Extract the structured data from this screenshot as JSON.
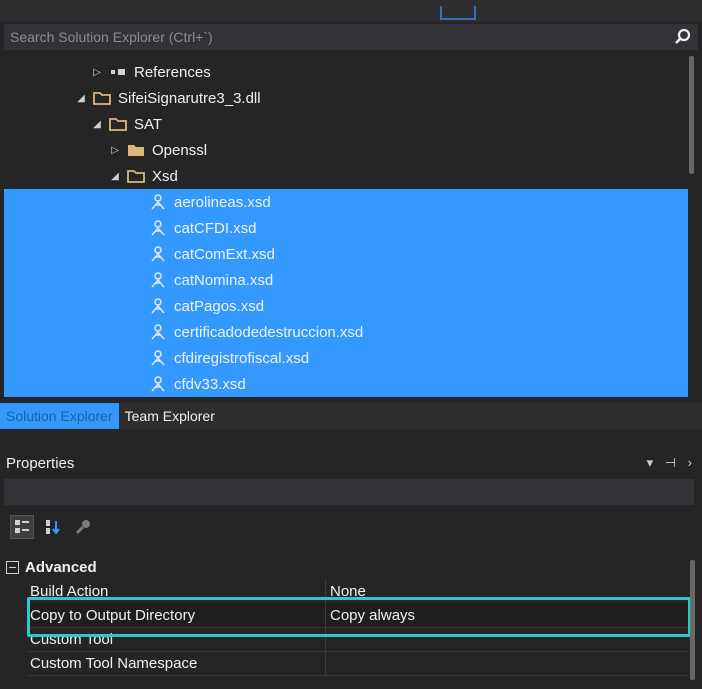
{
  "search": {
    "placeholder": "Search Solution Explorer (Ctrl+`)",
    "icon": "search-icon"
  },
  "tree": {
    "items": [
      {
        "label": "References",
        "level": 1,
        "expander": "collapsed",
        "icon": "references-icon",
        "selected": false
      },
      {
        "label": "SifeiSignarutre3_3.dll",
        "level": 1,
        "expander": "expanded",
        "icon": "folder-open-icon",
        "selected": false
      },
      {
        "label": "SAT",
        "level": 2,
        "expander": "expanded",
        "icon": "folder-open-icon",
        "selected": false
      },
      {
        "label": "Openssl",
        "level": 3,
        "expander": "collapsed",
        "icon": "folder-icon",
        "selected": false
      },
      {
        "label": "Xsd",
        "level": 3,
        "expander": "expanded",
        "icon": "folder-open-icon",
        "selected": false
      },
      {
        "label": "aerolineas.xsd",
        "level": 4,
        "expander": "none",
        "icon": "xsd-file-icon",
        "selected": true
      },
      {
        "label": "catCFDI.xsd",
        "level": 4,
        "expander": "none",
        "icon": "xsd-file-icon",
        "selected": true
      },
      {
        "label": "catComExt.xsd",
        "level": 4,
        "expander": "none",
        "icon": "xsd-file-icon",
        "selected": true
      },
      {
        "label": "catNomina.xsd",
        "level": 4,
        "expander": "none",
        "icon": "xsd-file-icon",
        "selected": true
      },
      {
        "label": "catPagos.xsd",
        "level": 4,
        "expander": "none",
        "icon": "xsd-file-icon",
        "selected": true
      },
      {
        "label": "certificadodedestruccion.xsd",
        "level": 4,
        "expander": "none",
        "icon": "xsd-file-icon",
        "selected": true
      },
      {
        "label": "cfdiregistrofiscal.xsd",
        "level": 4,
        "expander": "none",
        "icon": "xsd-file-icon",
        "selected": true
      },
      {
        "label": "cfdv33.xsd",
        "level": 4,
        "expander": "none",
        "icon": "xsd-file-icon",
        "selected": true
      }
    ]
  },
  "tabs": [
    {
      "label": "Solution Explorer",
      "active": true
    },
    {
      "label": "Team Explorer",
      "active": false
    }
  ],
  "properties": {
    "title": "Properties",
    "controls": "▾ ⊣ ›",
    "category": "Advanced",
    "rows": [
      {
        "name": "Build Action",
        "value": "None"
      },
      {
        "name": "Copy to Output Directory",
        "value": "Copy always",
        "highlighted": true
      },
      {
        "name": "Custom Tool",
        "value": ""
      },
      {
        "name": "Custom Tool Namespace",
        "value": ""
      }
    ]
  },
  "colors": {
    "selection": "#3399ff",
    "highlight_border": "#2ec8c8",
    "background": "#252526"
  }
}
